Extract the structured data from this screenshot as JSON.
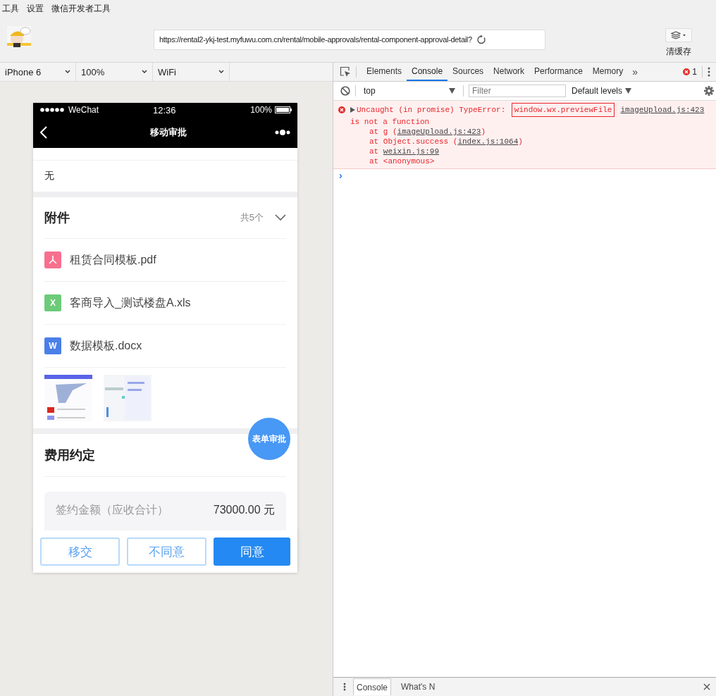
{
  "menu_bar": [
    "工具",
    "设置",
    "微信开发者工具"
  ],
  "toolbar": {
    "address": "https://rental2-ykj-test.myfuwu.com.cn/rental/mobile-approvals/rental-component-approval-detail?",
    "clear_cache": "清缓存"
  },
  "simulator_bar": [
    {
      "label": "iPhone 6"
    },
    {
      "label": "100%"
    },
    {
      "label": "WiFi"
    }
  ],
  "phone": {
    "status": {
      "carrier": "WeChat",
      "time": "12:36",
      "battery": "100%"
    },
    "nav_title": "移动审批",
    "remark": "无",
    "attachments": {
      "title": "附件",
      "count": "共5个",
      "expanded": true,
      "files": [
        {
          "kind": "pdf",
          "name": "租赁合同模板.pdf",
          "color": "#f7708e"
        },
        {
          "kind": "sheet",
          "icon_letter": "X",
          "name": "客商导入_测试楼盘A.xls",
          "color": "#6ccb78"
        },
        {
          "kind": "doc",
          "icon_letter": "W",
          "name": "数据模板.docx",
          "color": "#4a7fe8"
        }
      ]
    },
    "fab": "表单审批",
    "fees": {
      "title": "费用约定",
      "rows": [
        {
          "label": "签约金额（应收合计）",
          "value": "73000.00 元"
        }
      ]
    },
    "actions": [
      {
        "kind": "outline",
        "label": "移交"
      },
      {
        "kind": "outline",
        "label": "不同意"
      },
      {
        "kind": "primary",
        "label": "同意"
      }
    ]
  },
  "devtools": {
    "tabs": [
      {
        "label": "Elements",
        "selected": false
      },
      {
        "label": "Console",
        "selected": true
      },
      {
        "label": "Sources",
        "selected": false
      },
      {
        "label": "Network",
        "selected": false
      },
      {
        "label": "Performance",
        "selected": false
      },
      {
        "label": "Memory",
        "selected": false
      }
    ],
    "more": "»",
    "error_count": "1",
    "context": "top",
    "filter_placeholder": "Filter",
    "levels": "Default levels",
    "error": {
      "expanded": false,
      "prefix": "Uncaught (in promise) TypeError: ",
      "highlight": "window.wx.previewFile",
      "source": "imageUpload.js:423",
      "rest": "is not a function",
      "stack": [
        {
          "before": "at g (",
          "link": "imageUpload.js:423",
          "after": ")"
        },
        {
          "before": "at Object.success (",
          "link": "index.js:1064",
          "after": ")"
        },
        {
          "before": "at ",
          "link": "weixin.js:99"
        },
        {
          "before": "at <anonymous>"
        }
      ]
    },
    "prompt": "›",
    "drawer_tabs": [
      {
        "label": "Console",
        "selected": true
      },
      {
        "label": "What's N",
        "selected": false
      }
    ]
  }
}
